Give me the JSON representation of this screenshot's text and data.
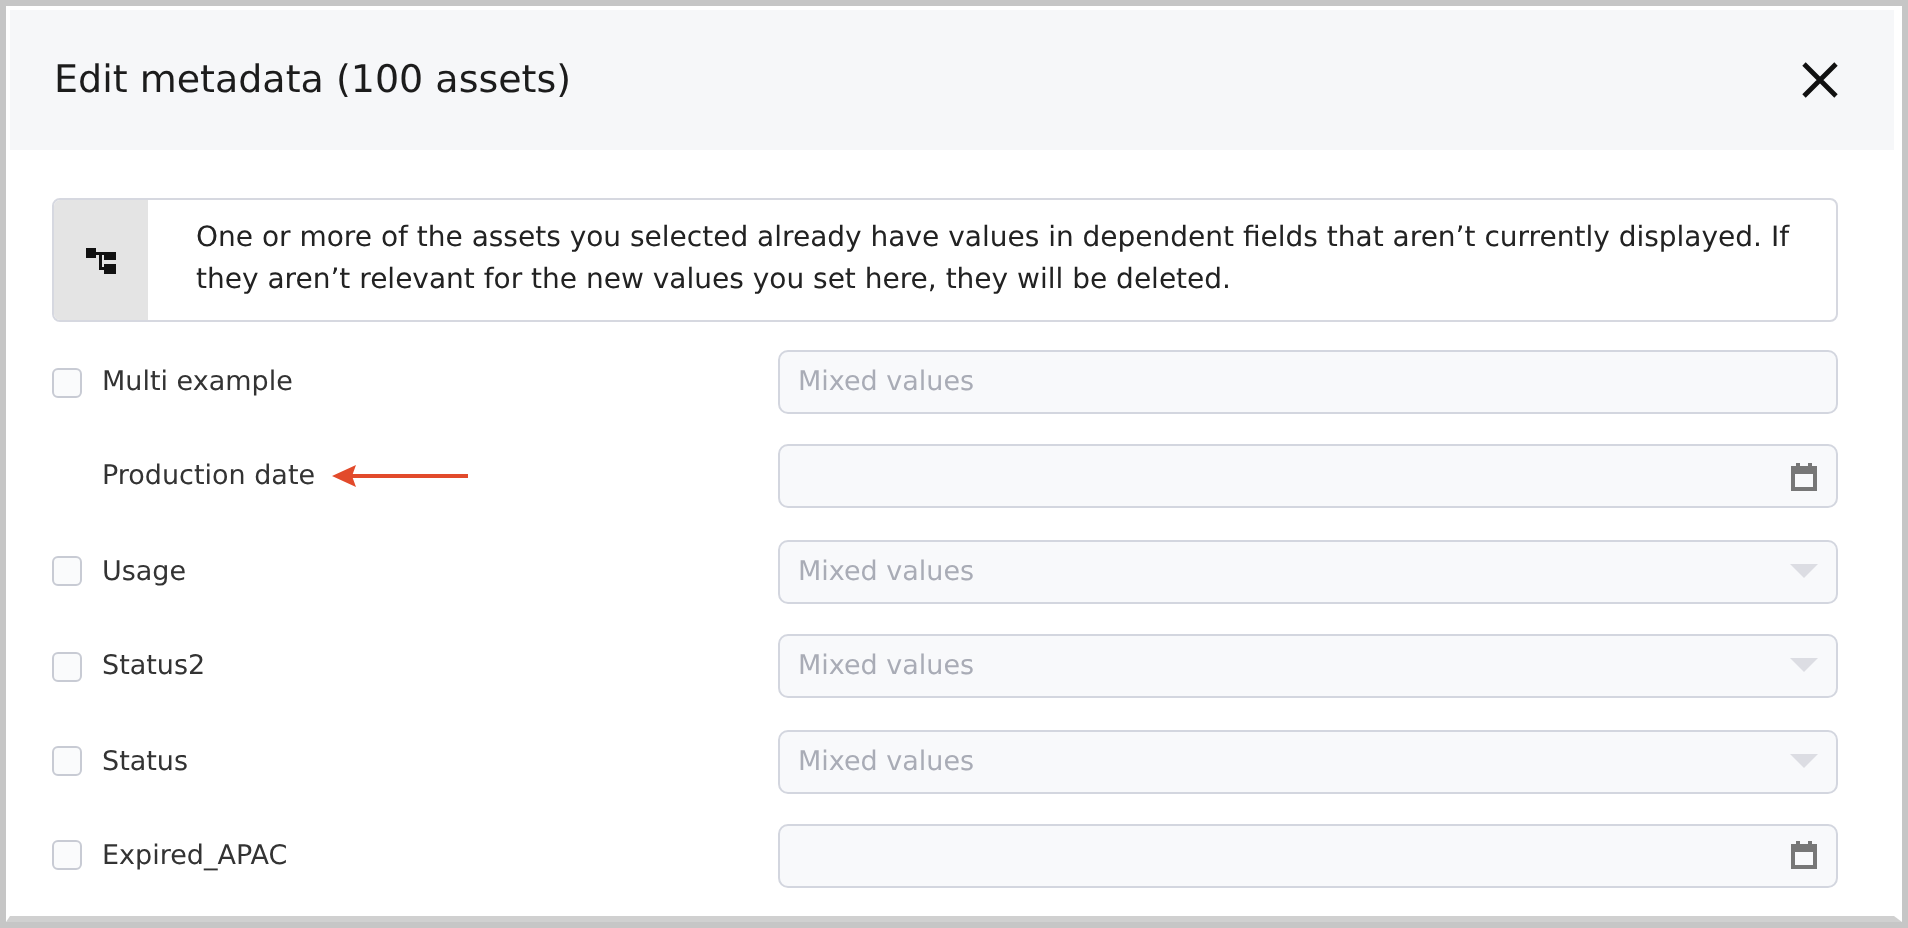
{
  "dialog": {
    "title": "Edit metadata (100 assets)"
  },
  "notice": {
    "text": "One or more of the assets you selected already have values in dependent fields that aren’t currently displayed. If they aren’t relevant for the new values you set here, they will be deleted."
  },
  "rows": [
    {
      "kind": "checkbox",
      "label": "Multi example",
      "checked": false,
      "field": {
        "kind": "text",
        "placeholder": "Mixed values"
      }
    },
    {
      "kind": "annotated",
      "label": "Production date",
      "field": {
        "kind": "date"
      }
    },
    {
      "kind": "checkbox",
      "label": "Usage",
      "checked": false,
      "field": {
        "kind": "select",
        "placeholder": "Mixed values"
      }
    },
    {
      "kind": "checkbox",
      "label": "Status2",
      "checked": false,
      "field": {
        "kind": "select",
        "placeholder": "Mixed values"
      }
    },
    {
      "kind": "checkbox",
      "label": "Status",
      "checked": false,
      "field": {
        "kind": "select",
        "placeholder": "Mixed values"
      }
    },
    {
      "kind": "checkbox",
      "label": "Expired_APAC",
      "checked": false,
      "field": {
        "kind": "date"
      }
    }
  ]
}
